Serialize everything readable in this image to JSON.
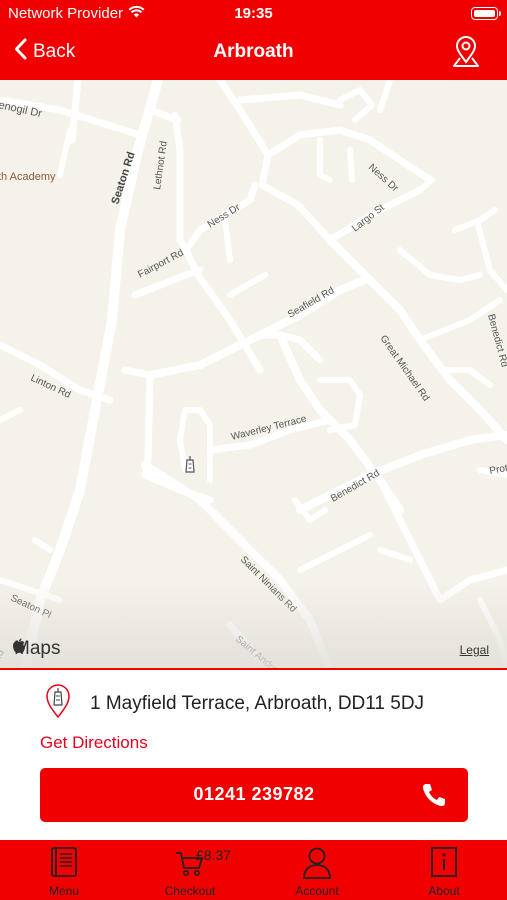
{
  "status_bar": {
    "carrier": "Network Provider",
    "time": "19:35"
  },
  "nav": {
    "back_label": "Back",
    "title": "Arbroath"
  },
  "map": {
    "streets": [
      "enogil Dr",
      "Seaton Rd",
      "th Academy",
      "Lethnot Rd",
      "Ness Dr",
      "Ness Dr",
      "Largo St",
      "Fairport Rd",
      "Seafield Rd",
      "Great Michael Rd",
      "Benedict Rd",
      "Linton Rd",
      "Waverley Terrace",
      "Benedict Rd",
      "Prot",
      "Saint Ninians Rd",
      "Seaton Pl",
      "Saint Andrew",
      "Rd"
    ],
    "attribution": "Maps",
    "legal_label": "Legal"
  },
  "location": {
    "address": "1 Mayfield Terrace, Arbroath, DD11 5DJ",
    "directions_label": "Get Directions",
    "phone": "01241 239782"
  },
  "tabs": [
    {
      "label": "Menu",
      "icon": "menu-book-icon"
    },
    {
      "label": "Checkout",
      "icon": "cart-icon",
      "price": "£8.37"
    },
    {
      "label": "Account",
      "icon": "person-icon"
    },
    {
      "label": "About",
      "icon": "info-icon"
    }
  ],
  "colors": {
    "brand_red": "#f00000",
    "link_red": "#e8001e",
    "map_bg": "#f5f2ea"
  }
}
